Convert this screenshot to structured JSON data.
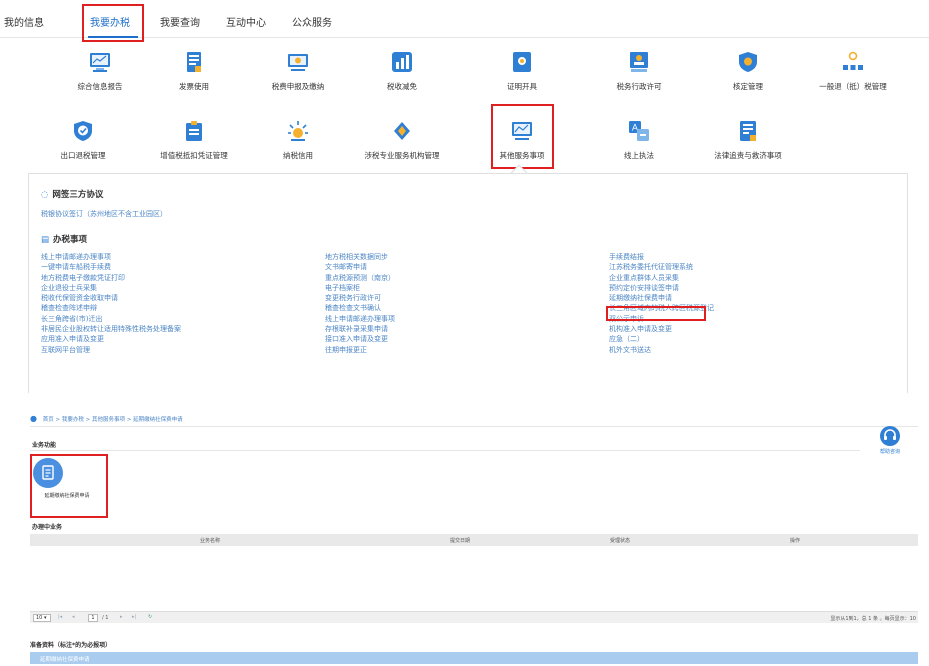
{
  "topnav": {
    "tabs": [
      "我的信息",
      "我要办税",
      "我要查询",
      "互动中心",
      "公众服务"
    ],
    "active": "我要办税"
  },
  "services": {
    "row1": [
      "综合信息报告",
      "发票使用",
      "税费申报及缴纳",
      "税收减免",
      "证明开具",
      "税务行政许可",
      "核定管理",
      "一般退（抵）税管理"
    ],
    "row2": [
      "出口退税管理",
      "增值税抵扣凭证管理",
      "纳税信用",
      "涉税专业服务机构管理",
      "其他服务事项",
      "线上执法",
      "法律追责与救济事项"
    ]
  },
  "panel": {
    "section1": {
      "title": "网签三方协议",
      "link": "税银协议签订（苏州地区不含工业园区）"
    },
    "section2": {
      "title": "办税事项",
      "col1": [
        "线上申请邮递办理事项",
        "一键申请车船税手续费",
        "地方税费电子缴款凭证打印",
        "企业退役士兵采集",
        "税收代保管资金收取申请",
        "稽查检查阵述申辩",
        "长三角跨省(市)迁出",
        "非居民企业股权转让适用特殊性税务处理备案",
        "应用准入申请及变更",
        "互联网平台管理"
      ],
      "col2": [
        "地方税相关数据同步",
        "文书邮寄申请",
        "重点税源预测（南京）",
        "电子档案柜",
        "变更税务行政许可",
        "稽查检查文书确认",
        "线上申请邮递办理事项",
        "存根联补录采集申请",
        "接口准入申请及变更",
        "往期申报更正"
      ],
      "col3": [
        "手续费结报",
        "江苏税务委托代征管理系统",
        "企业重点群体人员采集",
        "预约定价安排谈签申请",
        "延期缴纳社保费申请",
        "长三角区域内的税人跨区税源登记",
        "双公示申诉",
        "机构准入申请及变更",
        "应急（二）",
        "机外文书送达"
      ],
      "highlighted": "延期缴纳社保费申请"
    }
  },
  "breadcrumb": [
    "首页",
    "我要办税",
    "其他服务事项",
    "延期缴纳社保费申请"
  ],
  "business": {
    "section_title": "业务功能",
    "function_label": "延期缴纳社保费申请",
    "help_label": "帮助咨询"
  },
  "in_progress": {
    "title": "办理中业务",
    "columns": [
      "业务名称",
      "提交日期",
      "受理状态",
      "操作"
    ]
  },
  "pager": {
    "page_size": "10",
    "current_page": "1",
    "total_pages": "/ 1",
    "info": "显示从1到1，总 1 条 。每页显示：10"
  },
  "materials": {
    "title": "准备资料（标注*的为必报项）",
    "item": "延期缴纳社保费申请"
  },
  "colors": {
    "accent": "#1e6fc9",
    "link": "#4c86c6",
    "highlight": "#e02020"
  }
}
